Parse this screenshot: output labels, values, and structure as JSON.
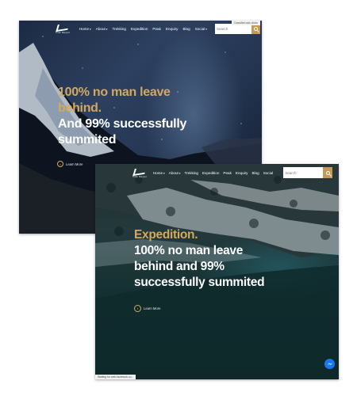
{
  "back_window": {
    "logo_text": "Trek Nepal",
    "nav": [
      {
        "label": "Home",
        "caret": true
      },
      {
        "label": "About",
        "caret": true
      },
      {
        "label": "Trekking",
        "caret": false
      },
      {
        "label": "Expedition",
        "caret": false
      },
      {
        "label": "Peak",
        "caret": false
      },
      {
        "label": "Enquiry",
        "caret": false
      },
      {
        "label": "Blog",
        "caret": false
      },
      {
        "label": "Social",
        "caret": true
      }
    ],
    "search_placeholder": "Search",
    "tooltip": "Classified ads clicks",
    "hero_line1": "100% no man leave",
    "hero_line2": "behind.",
    "hero_line3": "And 99% successfully",
    "hero_line4": "summited",
    "learn_more": "Learn More"
  },
  "front_window": {
    "logo_text": "Trek Nepal",
    "nav": [
      {
        "label": "Home",
        "caret": true
      },
      {
        "label": "About",
        "caret": true
      },
      {
        "label": "Trekking",
        "caret": false
      },
      {
        "label": "Expedition",
        "caret": false
      },
      {
        "label": "Peak",
        "caret": false
      },
      {
        "label": "Enquiry",
        "caret": false
      },
      {
        "label": "Blog",
        "caret": false
      },
      {
        "label": "Social",
        "caret": false
      }
    ],
    "search_placeholder": "Search",
    "hero_line1": "Expedition.",
    "hero_line2": "100% no man leave",
    "hero_line3": "behind and 99%",
    "hero_line4": "successfully summited",
    "learn_more": "Learn More",
    "status_text": "Waiting for web.facebook.co..."
  },
  "colors": {
    "accent_gold": "#d4a85f",
    "search_button": "#c69a55",
    "messenger_blue": "#1877f2"
  }
}
